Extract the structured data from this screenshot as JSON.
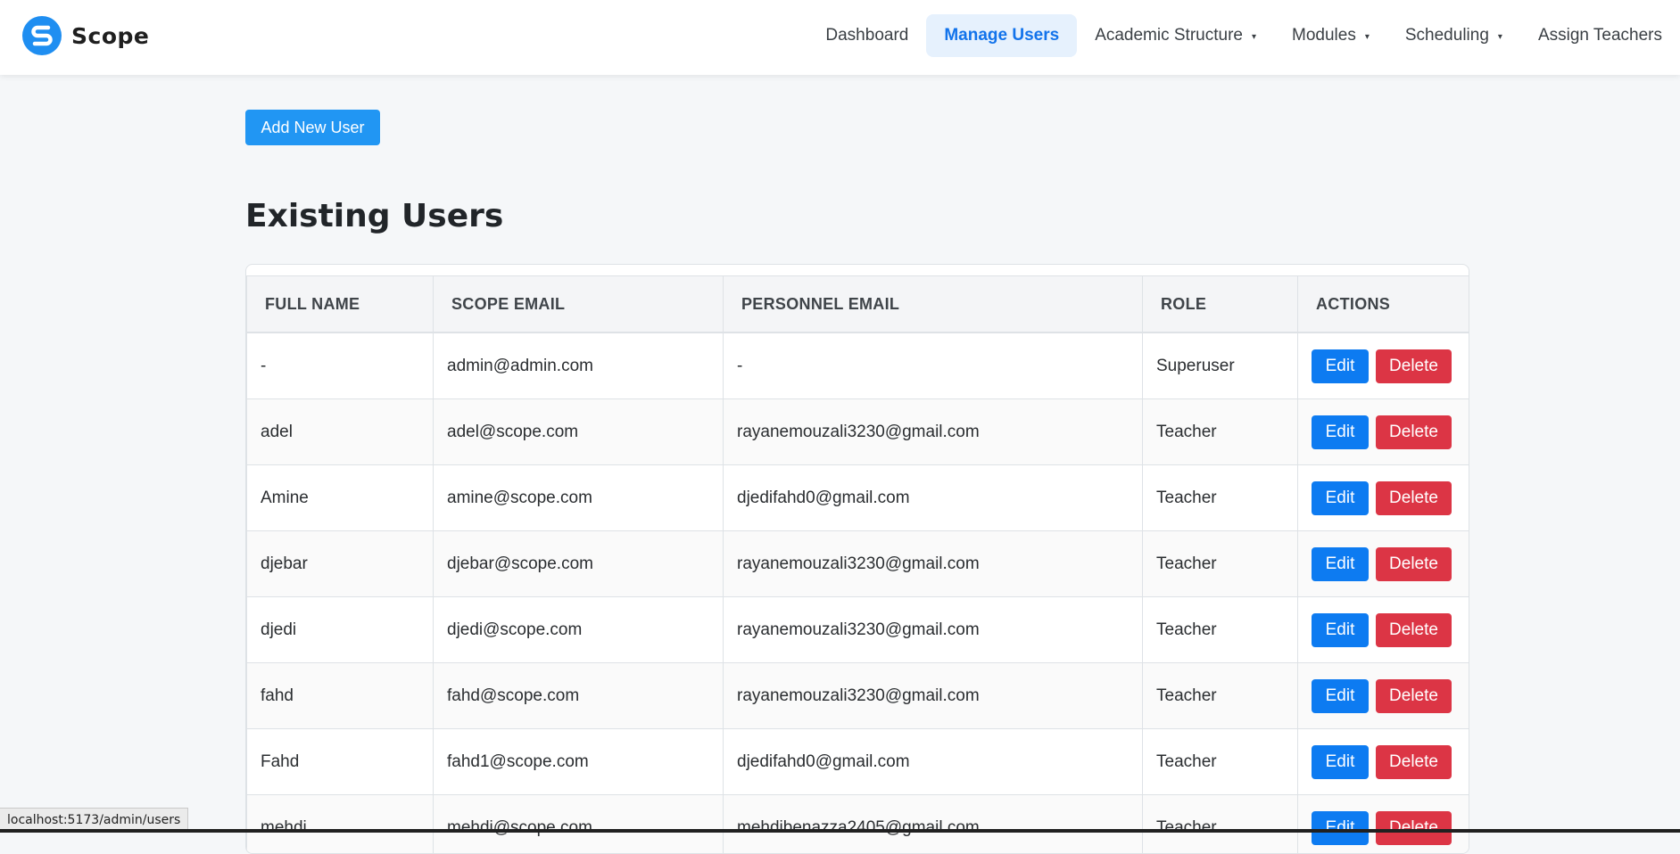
{
  "brand": {
    "name": "Scope",
    "logo_icon": "scope-logo-icon",
    "logo_color": "#1f8ef1"
  },
  "nav": {
    "items": [
      {
        "label": "Dashboard",
        "active": false,
        "dropdown": false
      },
      {
        "label": "Manage Users",
        "active": true,
        "dropdown": false
      },
      {
        "label": "Academic Structure",
        "active": false,
        "dropdown": true
      },
      {
        "label": "Modules",
        "active": false,
        "dropdown": true
      },
      {
        "label": "Scheduling",
        "active": false,
        "dropdown": true
      },
      {
        "label": "Assign Teachers",
        "active": false,
        "dropdown": false
      }
    ],
    "caret_icon": "caret-down-icon",
    "active_color": "#1273eb"
  },
  "main": {
    "add_button_label": "Add New User",
    "title": "Existing Users",
    "table": {
      "columns": [
        "FULL NAME",
        "SCOPE EMAIL",
        "PERSONNEL EMAIL",
        "ROLE",
        "ACTIONS"
      ],
      "rows": [
        {
          "full_name": "-",
          "scope_email": "admin@admin.com",
          "personnel_email": "-",
          "role": "Superuser"
        },
        {
          "full_name": "adel",
          "scope_email": "adel@scope.com",
          "personnel_email": "rayanemouzali3230@gmail.com",
          "role": "Teacher"
        },
        {
          "full_name": "Amine",
          "scope_email": "amine@scope.com",
          "personnel_email": "djedifahd0@gmail.com",
          "role": "Teacher"
        },
        {
          "full_name": "djebar",
          "scope_email": "djebar@scope.com",
          "personnel_email": "rayanemouzali3230@gmail.com",
          "role": "Teacher"
        },
        {
          "full_name": "djedi",
          "scope_email": "djedi@scope.com",
          "personnel_email": "rayanemouzali3230@gmail.com",
          "role": "Teacher"
        },
        {
          "full_name": "fahd",
          "scope_email": "fahd@scope.com",
          "personnel_email": "rayanemouzali3230@gmail.com",
          "role": "Teacher"
        },
        {
          "full_name": "Fahd",
          "scope_email": "fahd1@scope.com",
          "personnel_email": "djedifahd0@gmail.com",
          "role": "Teacher"
        },
        {
          "full_name": "mehdi",
          "scope_email": "mehdi@scope.com",
          "personnel_email": "mehdibenazza2405@gmail.com",
          "role": "Teacher"
        }
      ],
      "edit_label": "Edit",
      "delete_label": "Delete",
      "edit_color": "#0d7bf1",
      "delete_color": "#dc3545"
    }
  },
  "status_bar": {
    "url": "localhost:5173/admin/users"
  }
}
